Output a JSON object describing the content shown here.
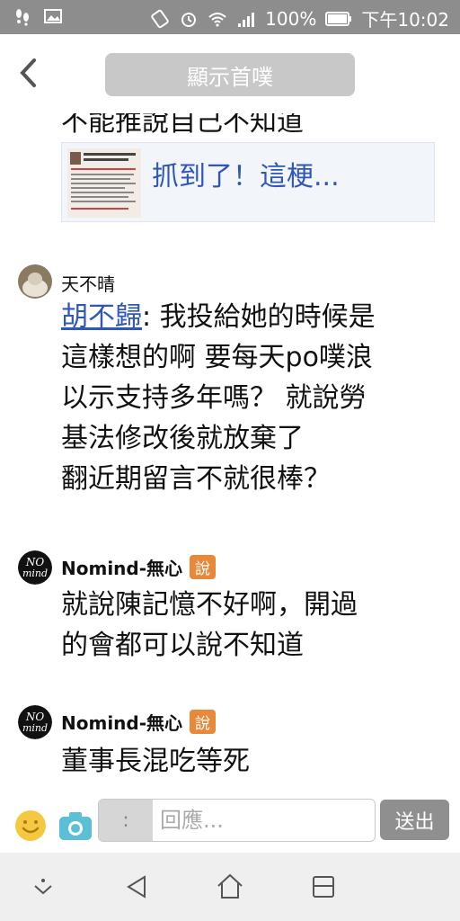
{
  "status_bar": {
    "battery": "100%",
    "time": "下午10:02"
  },
  "header": {
    "home_button_label": "顯示首噗"
  },
  "feed": {
    "cut_text": "不能推說自己不知道",
    "link_card": {
      "title": "抓到了！這梗..."
    },
    "responses": [
      {
        "name": "天不晴",
        "qualifier": "",
        "mention": "胡不歸",
        "lines": [
          ": 我投給她的時候是",
          "這樣想的啊 要每天po噗浪",
          "以示支持多年嗎？ 就說勞",
          "基法修改後就放棄了",
          "翻近期留言不就很棒？"
        ]
      },
      {
        "name": "Nomind-無心",
        "qualifier": "說",
        "lines": [
          "就說陳記憶不好啊，開過",
          "的會都可以說不知道"
        ]
      },
      {
        "name": "Nomind-無心",
        "qualifier": "說",
        "lines": [
          "董事長混吃等死"
        ]
      }
    ]
  },
  "compose": {
    "qualifier_symbol": ":",
    "placeholder": "回應...",
    "send_label": "送出"
  },
  "colors": {
    "status_bar": "#8d8d8d",
    "link": "#2f57b5",
    "qualifier_orange": "#e8893a",
    "send_button": "#8f8f8f"
  }
}
